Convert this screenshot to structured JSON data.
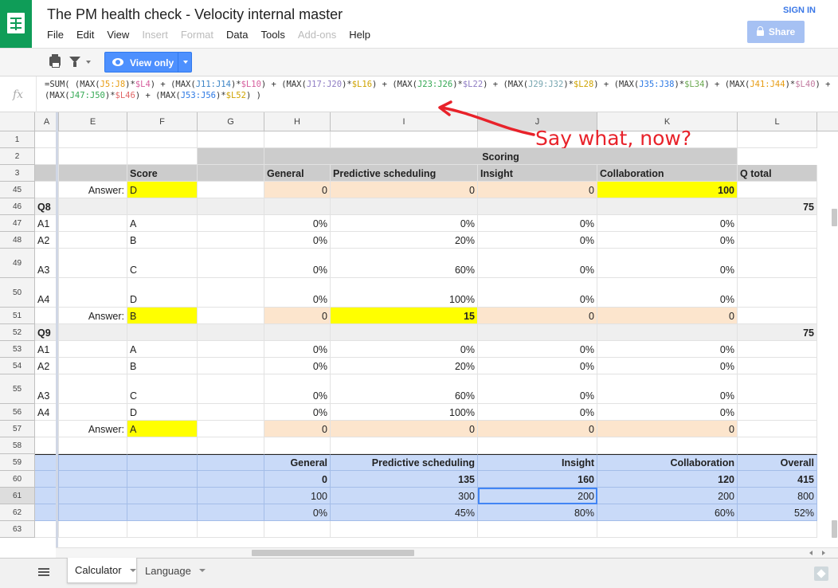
{
  "app": {
    "title": "The PM health check - Velocity internal master",
    "sign_in": "SIGN IN",
    "share": "Share",
    "menu": [
      {
        "label": "File",
        "disabled": false
      },
      {
        "label": "Edit",
        "disabled": false
      },
      {
        "label": "View",
        "disabled": false
      },
      {
        "label": "Insert",
        "disabled": true
      },
      {
        "label": "Format",
        "disabled": true
      },
      {
        "label": "Data",
        "disabled": false
      },
      {
        "label": "Tools",
        "disabled": false
      },
      {
        "label": "Add-ons",
        "disabled": true
      },
      {
        "label": "Help",
        "disabled": false
      }
    ]
  },
  "toolbar": {
    "view_only": "View only",
    "icons": [
      "print-icon",
      "filter-icon"
    ]
  },
  "formula": {
    "fx": "fx",
    "parts": [
      {
        "t": "=SUM( (MAX("
      },
      {
        "t": "J5:J8",
        "c": "rf-a"
      },
      {
        "t": ")*"
      },
      {
        "t": "$L4",
        "c": "rf-b"
      },
      {
        "t": ") + (MAX("
      },
      {
        "t": "J11:J14",
        "c": "rf-c"
      },
      {
        "t": ")*"
      },
      {
        "t": "$L10",
        "c": "rf-b"
      },
      {
        "t": ") + (MAX("
      },
      {
        "t": "J17:J20",
        "c": "rf-f"
      },
      {
        "t": ")*"
      },
      {
        "t": "$L16",
        "c": "rf-e"
      },
      {
        "t": ") + (MAX("
      },
      {
        "t": "J23:J26",
        "c": "rf-d"
      },
      {
        "t": ")*"
      },
      {
        "t": "$L22",
        "c": "rf-f"
      },
      {
        "t": ") + (MAX("
      },
      {
        "t": "J29:J32",
        "c": "rf-g"
      },
      {
        "t": ")*"
      },
      {
        "t": "$L28",
        "c": "rf-e"
      },
      {
        "t": ") + (MAX("
      },
      {
        "t": "J35:J38",
        "c": "rf-j"
      },
      {
        "t": ")*"
      },
      {
        "t": "$L34",
        "c": "rf-i"
      },
      {
        "t": ") + (MAX("
      },
      {
        "t": "J41:J44",
        "c": "rf-a"
      },
      {
        "t": ")*"
      },
      {
        "t": "$L40",
        "c": "rf-k"
      },
      {
        "t": ") + (MAX("
      },
      {
        "t": "J47:J50",
        "c": "rf-d"
      },
      {
        "t": ")*"
      },
      {
        "t": "$L46",
        "c": "rf-h"
      },
      {
        "t": ") + (MAX("
      },
      {
        "t": "J53:J56",
        "c": "rf-j"
      },
      {
        "t": ")*"
      },
      {
        "t": "$L52",
        "c": "rf-e"
      },
      {
        "t": ") )"
      }
    ]
  },
  "annotation": "Say what, now?",
  "columns": [
    "A",
    "E",
    "F",
    "G",
    "H",
    "I",
    "J",
    "K",
    "L"
  ],
  "colors": {
    "yellow": "#ffff00",
    "peach": "#fce5cd",
    "section_gray": "#efefef",
    "header_gray": "#cccccc",
    "summary_blue": "#c9daf8",
    "annotation_red": "#e8222a"
  },
  "rows": [
    {
      "num": "1",
      "cells": {}
    },
    {
      "num": "2",
      "cells": {
        "I": "Scoring"
      }
    },
    {
      "num": "3",
      "cells": {
        "F": "Score",
        "H": "General",
        "I": "Predictive scheduling",
        "J": "Insight",
        "K": "Collaboration",
        "L": "Q total"
      }
    },
    {
      "num": "45",
      "cells": {
        "E": "Answer:",
        "F": "D",
        "H": "0",
        "I": "0",
        "J": "0",
        "K": "100"
      }
    },
    {
      "num": "46",
      "cells": {
        "A": "Q8",
        "L": "75"
      }
    },
    {
      "num": "47",
      "cells": {
        "A": "A1",
        "F": "A",
        "H": "0%",
        "I": "0%",
        "J": "0%",
        "K": "0%"
      }
    },
    {
      "num": "48",
      "cells": {
        "A": "A2",
        "F": "B",
        "H": "0%",
        "I": "20%",
        "J": "0%",
        "K": "0%"
      }
    },
    {
      "num": "49",
      "cells": {
        "A": "A3",
        "F": "C",
        "H": "0%",
        "I": "60%",
        "J": "0%",
        "K": "0%"
      }
    },
    {
      "num": "50",
      "cells": {
        "A": "A4",
        "F": "D",
        "H": "0%",
        "I": "100%",
        "J": "0%",
        "K": "0%"
      }
    },
    {
      "num": "51",
      "cells": {
        "E": "Answer:",
        "F": "B",
        "H": "0",
        "I": "15",
        "J": "0",
        "K": "0"
      }
    },
    {
      "num": "52",
      "cells": {
        "A": "Q9",
        "L": "75"
      }
    },
    {
      "num": "53",
      "cells": {
        "A": "A1",
        "F": "A",
        "H": "0%",
        "I": "0%",
        "J": "0%",
        "K": "0%"
      }
    },
    {
      "num": "54",
      "cells": {
        "A": "A2",
        "F": "B",
        "H": "0%",
        "I": "20%",
        "J": "0%",
        "K": "0%"
      }
    },
    {
      "num": "55",
      "cells": {
        "A": "A3",
        "F": "C",
        "H": "0%",
        "I": "60%",
        "J": "0%",
        "K": "0%"
      }
    },
    {
      "num": "56",
      "cells": {
        "A": "A4",
        "F": "D",
        "H": "0%",
        "I": "100%",
        "J": "0%",
        "K": "0%"
      }
    },
    {
      "num": "57",
      "cells": {
        "E": "Answer:",
        "F": "A",
        "H": "0",
        "I": "0",
        "J": "0",
        "K": "0"
      }
    },
    {
      "num": "58",
      "cells": {}
    },
    {
      "num": "59",
      "cells": {
        "H": "General",
        "I": "Predictive scheduling",
        "J": "Insight",
        "K": "Collaboration",
        "L": "Overall"
      }
    },
    {
      "num": "60",
      "cells": {
        "H": "0",
        "I": "135",
        "J": "160",
        "K": "120",
        "L": "415"
      }
    },
    {
      "num": "61",
      "cells": {
        "H": "100",
        "I": "300",
        "J": "200",
        "K": "200",
        "L": "800"
      }
    },
    {
      "num": "62",
      "cells": {
        "H": "0%",
        "I": "45%",
        "J": "80%",
        "K": "60%",
        "L": "52%"
      }
    },
    {
      "num": "63",
      "cells": {}
    }
  ],
  "sheets": [
    {
      "label": "Calculator",
      "active": true
    },
    {
      "label": "Language",
      "active": false
    }
  ]
}
